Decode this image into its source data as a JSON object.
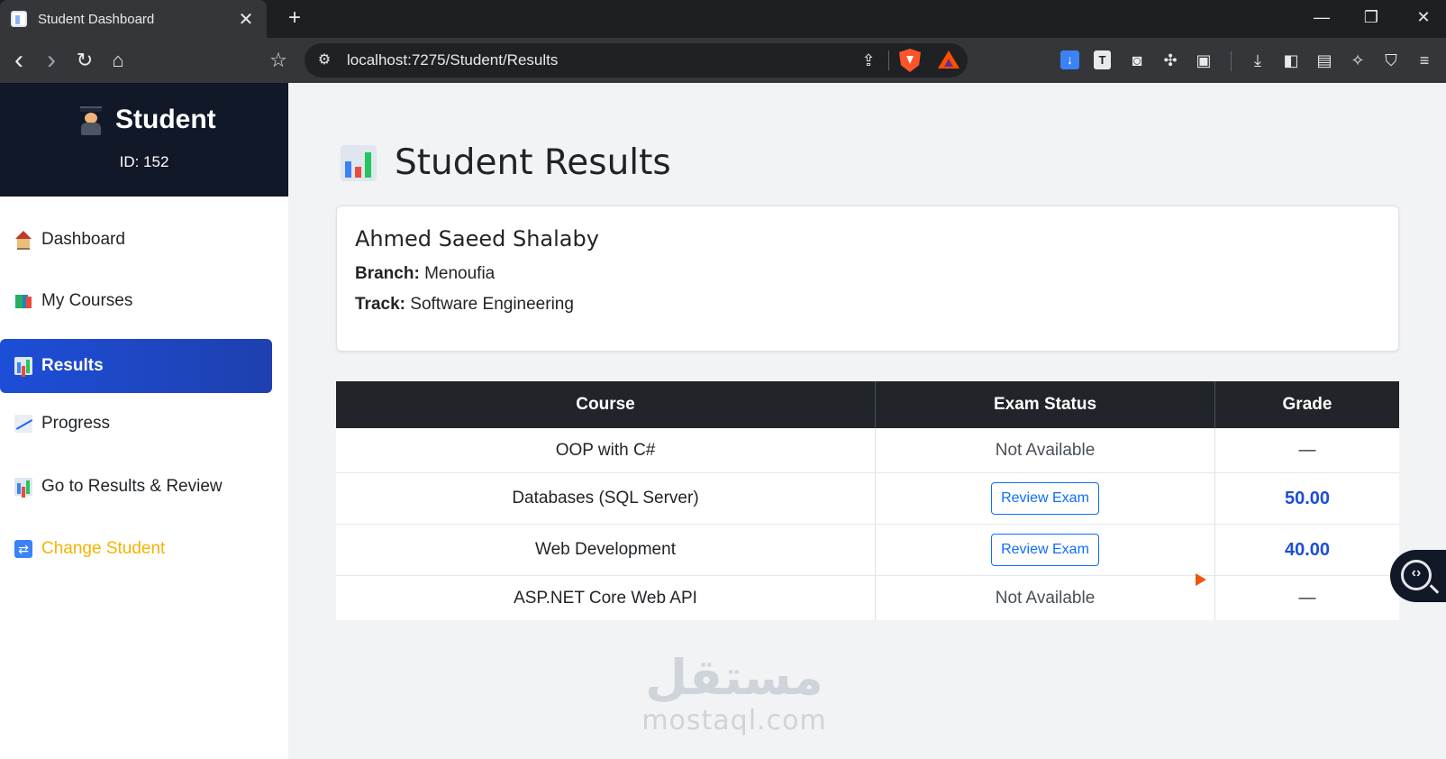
{
  "browser": {
    "tab_title": "Student Dashboard",
    "tab_close": "✕",
    "new_tab": "+",
    "url": "localhost:7275/Student/Results",
    "window_controls": {
      "minimize": "—",
      "restore": "❐",
      "close": "✕"
    },
    "nav": {
      "back": "‹",
      "forward": "›",
      "reload": "↻",
      "home": "⌂",
      "bookmark": "☆"
    }
  },
  "sidebar": {
    "title": "Student",
    "id_text": "ID: 152",
    "items": [
      {
        "label": "Dashboard",
        "icon": "house-icon"
      },
      {
        "label": "My Courses",
        "icon": "books-icon"
      },
      {
        "label": "Results",
        "icon": "bar-chart-icon",
        "active": true
      },
      {
        "label": "Progress",
        "icon": "chart-up-icon"
      },
      {
        "label": "Go to Results & Review",
        "icon": "bar-chart-icon"
      },
      {
        "label": "Change Student",
        "icon": "swap-icon",
        "color": "#f5b300"
      }
    ]
  },
  "main": {
    "title": "Student Results",
    "student": {
      "name": "Ahmed Saeed Shalaby",
      "branch_label": "Branch:",
      "branch": "Menoufia",
      "track_label": "Track:",
      "track": "Software Engineering"
    },
    "table": {
      "headers": [
        "Course",
        "Exam Status",
        "Grade"
      ],
      "rows": [
        {
          "course": "OOP with C#",
          "status": "Not Available",
          "grade": "—"
        },
        {
          "course": "Databases (SQL Server)",
          "status": "Review Exam",
          "grade": "50.00"
        },
        {
          "course": "Web Development",
          "status": "Review Exam",
          "grade": "40.00"
        },
        {
          "course": "ASP.NET Core Web API",
          "status": "Not Available",
          "grade": "—"
        }
      ]
    }
  },
  "watermark": {
    "arabic": "مستقل",
    "latin": "mostaql.com"
  },
  "colors": {
    "accent": "#1d4ed8",
    "sidebar_header": "#111827",
    "table_header": "#212529",
    "warning": "#f5b300"
  }
}
